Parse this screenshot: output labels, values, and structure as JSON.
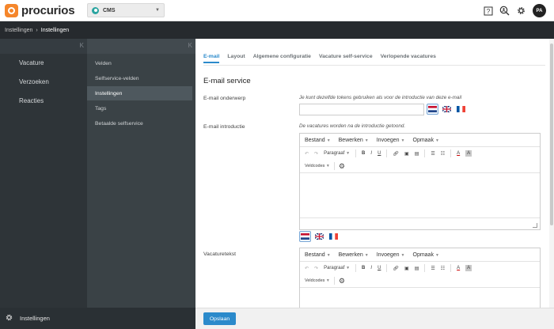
{
  "brand": {
    "name": "procurios"
  },
  "app_select": {
    "value": "CMS"
  },
  "user": {
    "initials": "PA"
  },
  "breadcrumb": {
    "root": "Instellingen",
    "current": "Instellingen",
    "separator": "›"
  },
  "nav_primary": {
    "collapse": "K",
    "items": [
      "Vacature",
      "Verzoeken",
      "Reacties"
    ]
  },
  "nav_secondary": {
    "collapse": "K",
    "items": [
      "Velden",
      "Selfservice-velden",
      "Instellingen",
      "Tags",
      "Betaalde selfservice"
    ],
    "active_index": 2
  },
  "footer_nav": {
    "label": "Instellingen"
  },
  "tabs": [
    "E-mail",
    "Layout",
    "Algemene configuratie",
    "Vacature self-service",
    "Verlopende vacatures"
  ],
  "section": {
    "title": "E-mail service",
    "subject_label": "E-mail onderwerp",
    "subject_hint": "Je kunt dezelfde tokens gebruiken als voor de introductie van deze e-mail",
    "subject_value": "",
    "intro_label": "E-mail introductie",
    "intro_hint": "De vacatures worden na de introductie getoond.",
    "vacature_label": "Vacaturetekst"
  },
  "editor": {
    "menus": [
      "Bestand",
      "Bewerken",
      "Invoegen",
      "Opmaak"
    ],
    "format": "Paragraaf",
    "field_codes": "Veldcodes"
  },
  "flags": [
    "nl-flag",
    "gb-flag",
    "fr-flag"
  ],
  "save_label": "Opslaan",
  "colors": {
    "accent": "#2b8acb",
    "sidebar_dark": "#2e3438",
    "sidebar_mid": "#3a4246",
    "brand_orange": "#f5862b"
  }
}
